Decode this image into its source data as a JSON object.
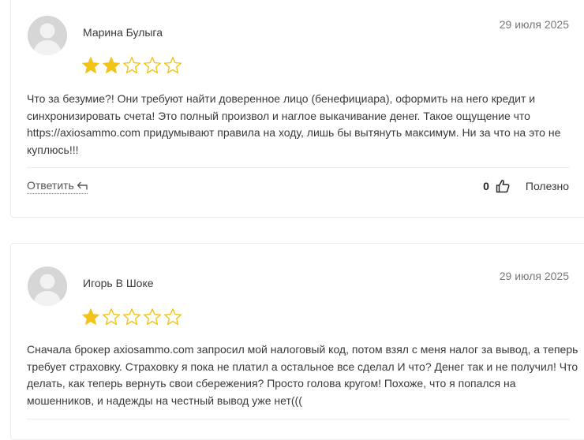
{
  "reviews": [
    {
      "author": "Марина Булыга",
      "date": "29 июля 2025",
      "rating": 2,
      "max_rating": 5,
      "text": "Что за безумие?! Они требуют найти доверенное лицо (бенефициара), оформить на него кредит и синхронизировать счета! Это полный произвол и наглое выкачивание денег. Такое ощущение что https://axiosammo.com придумывают правила на ходу, лишь бы вытянуть максимум. Ни за что на это не куплюсь!!!",
      "reply_label": "Ответить",
      "helpful_count": "0",
      "helpful_label": "Полезно"
    },
    {
      "author": "Игорь В Шоке",
      "date": "29 июля 2025",
      "rating": 1,
      "max_rating": 5,
      "text": "Сначала брокер axiosammo.com запросил мой налоговый код, потом взял с меня налог за вывод, а теперь требует страховку. Страховку я пока не платил а остальное все сделал И что? Денег так и не получил! Что делать, как теперь вернуть свои сбережения? Просто голова кругом! Похоже, что я попался на мошенников, и надежды на честный вывод уже нет((("
    }
  ],
  "colors": {
    "star_filled": "#f2c418",
    "star_outline": "#f2c418",
    "avatar_bg": "#d6d6d6",
    "avatar_figure": "#f2f2f2",
    "card_border": "#ececec"
  },
  "icons": {
    "avatar": "user-silhouette-icon",
    "star": "star-icon",
    "reply": "reply-arrow-icon",
    "helpful": "thumbs-up-icon"
  }
}
